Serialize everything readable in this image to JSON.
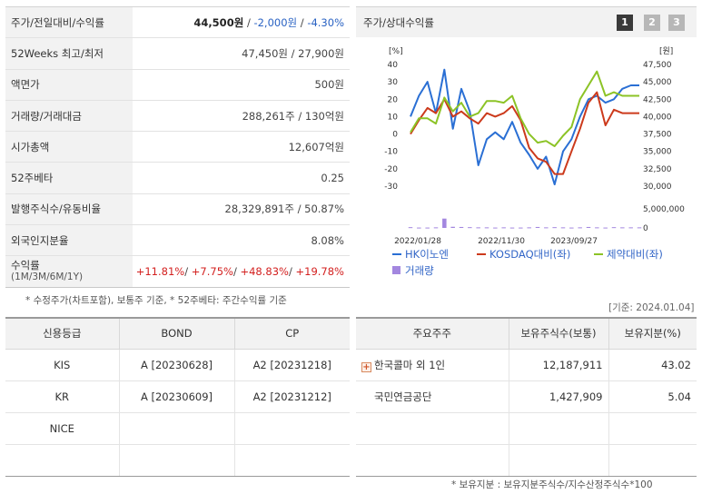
{
  "info": {
    "rows": [
      {
        "label": "주가/전일대비/수익률",
        "price": "44,500원",
        "change": "-2,000원",
        "rate": "-4.30%"
      },
      {
        "label": "52Weeks 최고/최저",
        "value": "47,450원 / 27,900원"
      },
      {
        "label": "액면가",
        "value": "500원"
      },
      {
        "label": "거래량/거래대금",
        "value": "288,261주 / 130억원"
      },
      {
        "label": "시가총액",
        "value": "12,607억원"
      },
      {
        "label": "52주베타",
        "value": "0.25"
      },
      {
        "label": "발행주식수/유동비율",
        "value": "28,329,891주 / 50.87%"
      },
      {
        "label": "외국인지분율",
        "value": "8.08%"
      },
      {
        "label": "수익률",
        "label_sub": "(1M/3M/6M/1Y)",
        "returns": [
          "+11.81%",
          "+7.75%",
          "+48.83%",
          "+19.78%"
        ]
      }
    ],
    "sep": "/",
    "note": "* 수정주가(차트포함), 보통주 기준, * 52주베타: 주간수익률 기준"
  },
  "chart_panel": {
    "title": "주가/상대수익률",
    "pages": [
      "1",
      "2",
      "3"
    ],
    "active_page": "1",
    "base_date": "[기준: 2024.01.04]"
  },
  "chart_data": {
    "type": "line",
    "left_axis": {
      "unit": "[%]",
      "min": -30,
      "max": 40,
      "ticks": [
        40,
        30,
        20,
        10,
        0,
        -10,
        -20,
        -30
      ]
    },
    "right_axis": {
      "unit": "[원]",
      "min": 30000,
      "max": 47500,
      "ticks": [
        "47,500",
        "45,000",
        "42,500",
        "40,000",
        "37,500",
        "35,000",
        "32,500",
        "30,000"
      ]
    },
    "volume_axis": {
      "min": 0,
      "max": 5000000,
      "ticks": [
        "5,000,000",
        "0"
      ]
    },
    "x_ticks": [
      "2022/01/28",
      "2022/11/30",
      "2023/09/27"
    ],
    "legend_position": "bottom",
    "grid": false,
    "series": [
      {
        "name": "HK이노엔",
        "color": "#2a6fd4",
        "values": [
          10,
          22,
          30,
          12,
          37,
          3,
          26,
          13,
          -18,
          -3,
          1,
          -3,
          7,
          -5,
          -12,
          -20,
          -13,
          -29,
          -10,
          -3,
          10,
          20,
          22,
          18,
          20,
          26,
          28,
          28
        ]
      },
      {
        "name": "KOSDAQ대비(좌)",
        "color": "#cc3a1c",
        "values": [
          0,
          8,
          15,
          12,
          20,
          10,
          13,
          9,
          6,
          12,
          10,
          12,
          16,
          8,
          -8,
          -14,
          -16,
          -23,
          -23,
          -10,
          3,
          18,
          24,
          5,
          14,
          12,
          12,
          12
        ]
      },
      {
        "name": "제약대비(좌)",
        "color": "#8cc326",
        "values": [
          1,
          9,
          9,
          6,
          21,
          13,
          18,
          10,
          12,
          19,
          19,
          18,
          22,
          9,
          0,
          -5,
          -4,
          -7,
          -1,
          4,
          20,
          28,
          36,
          22,
          24,
          22,
          22,
          22
        ]
      }
    ],
    "volume": {
      "name": "거래량",
      "color": "#a387df",
      "values": [
        200000,
        100000,
        100000,
        150000,
        2450000,
        300000,
        250000,
        200000,
        150000,
        150000,
        100000,
        150000,
        100000,
        100000,
        150000,
        250000,
        150000,
        200000,
        150000,
        100000,
        150000,
        250000,
        150000,
        100000,
        200000,
        150000,
        150000,
        150000
      ]
    }
  },
  "credit": {
    "headers": [
      "신용등급",
      "BOND",
      "CP"
    ],
    "rows": [
      [
        "KIS",
        "A  [20230628]",
        "A2  [20231218]"
      ],
      [
        "KR",
        "A  [20230609]",
        "A2  [20231212]"
      ],
      [
        "NICE",
        "",
        ""
      ],
      [
        "",
        "",
        ""
      ]
    ]
  },
  "holders": {
    "headers": [
      "주요주주",
      "보유주식수(보통)",
      "보유지분(%)"
    ],
    "rows": [
      {
        "name": "한국콜마 외 1인",
        "shares": "12,187,911",
        "pct": "43.02",
        "expand_icon": "plus-icon"
      },
      {
        "name": "국민연금공단",
        "shares": "1,427,909",
        "pct": "5.04"
      },
      {
        "name": "",
        "shares": "",
        "pct": ""
      },
      {
        "name": "",
        "shares": "",
        "pct": ""
      }
    ],
    "note": "* 보유지분 : 보유지분주식수/지수산정주식수*100"
  }
}
